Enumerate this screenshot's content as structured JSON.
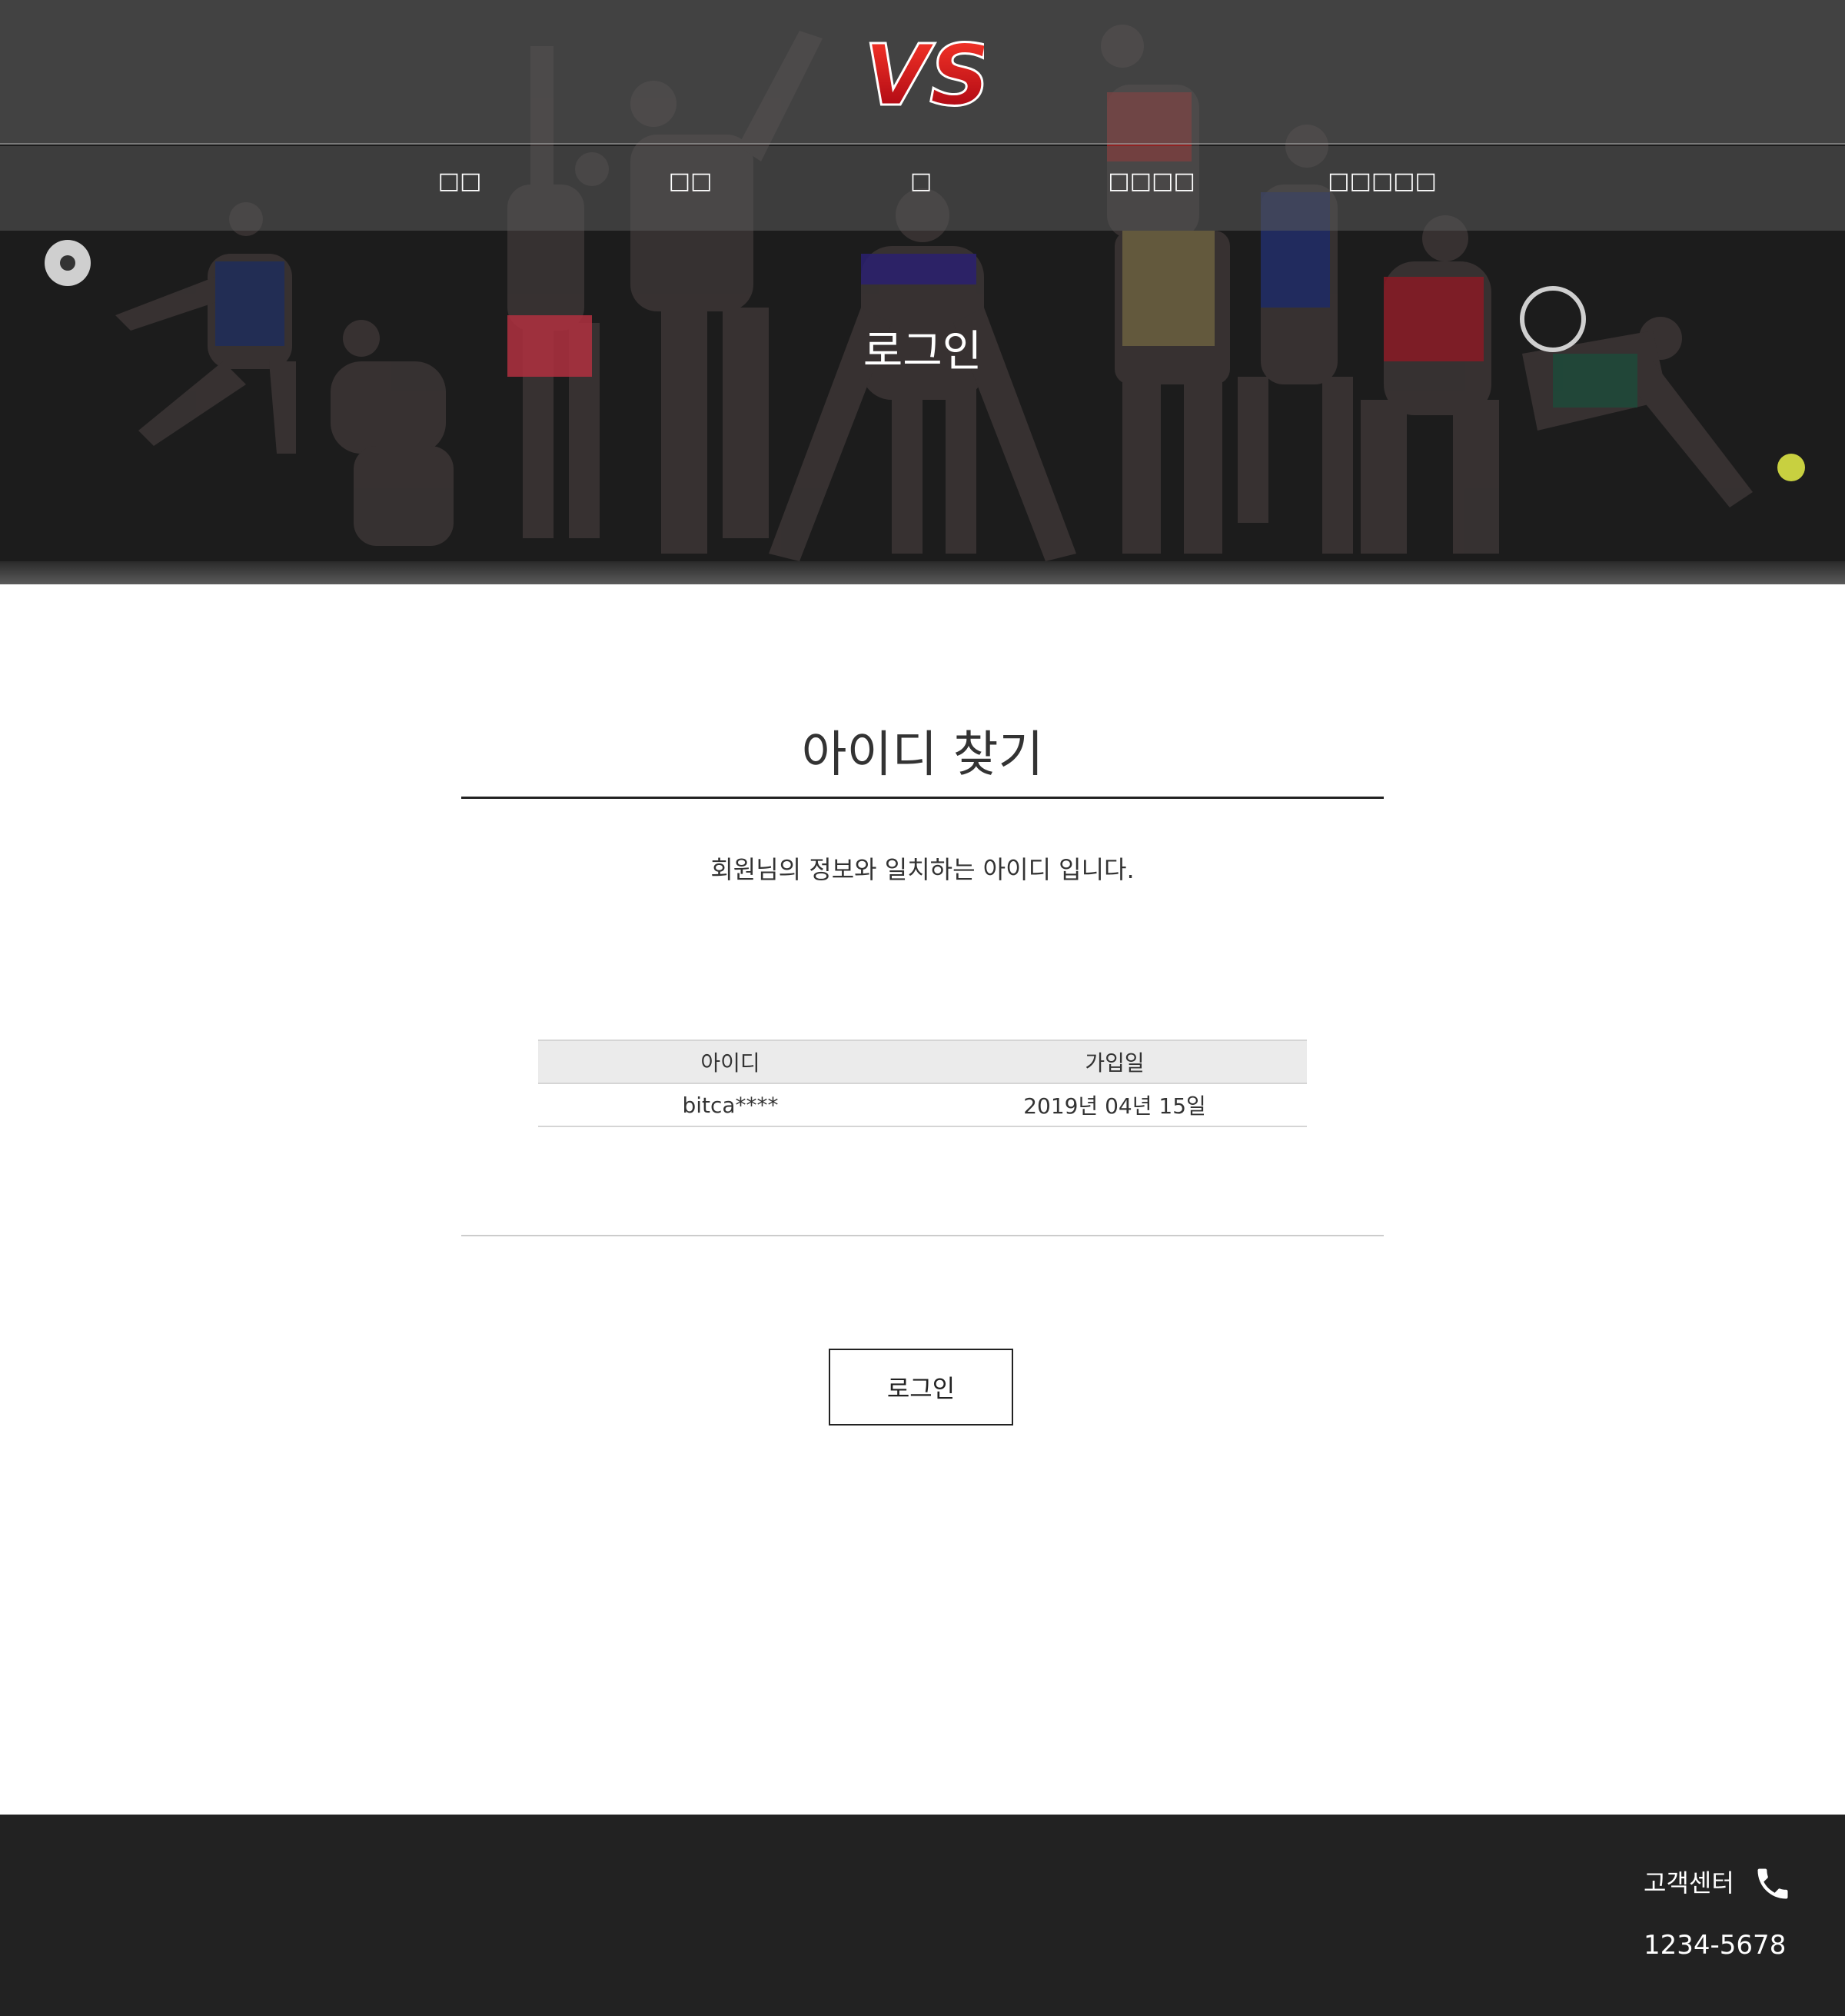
{
  "header": {
    "logo_text": "VS",
    "nav": [
      {
        "label": "□□"
      },
      {
        "label": "□□"
      },
      {
        "label": "□"
      },
      {
        "label": "□□□□"
      },
      {
        "label": "□□□□□"
      }
    ],
    "hero_title": "로그인"
  },
  "main": {
    "title": "아이디 찾기",
    "message": "회원님의 정보와 일치하는 아이디 입니다.",
    "table": {
      "columns": [
        "아이디",
        "가입일"
      ],
      "rows": [
        [
          "bitca****",
          "2019년 04년 15일"
        ]
      ]
    },
    "login_button_label": "로그인"
  },
  "footer": {
    "cs_label": "고객센터",
    "cs_phone": "1234-5678"
  },
  "colors": {
    "footer_bg": "#222222",
    "hero_bg": "#1c1c1c",
    "logo_red": "#d0101a"
  }
}
